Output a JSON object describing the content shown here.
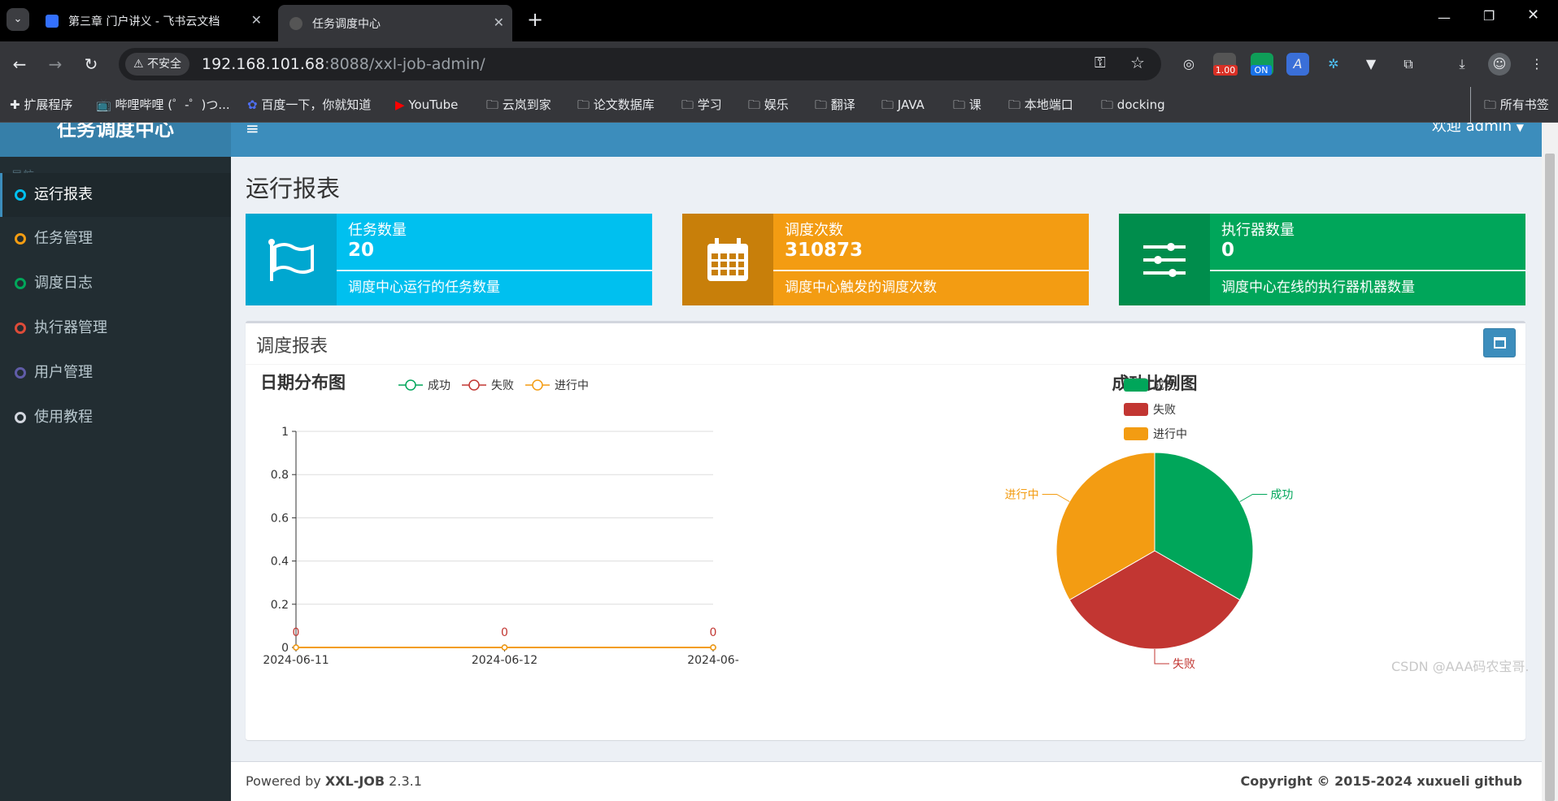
{
  "browser": {
    "tabs": [
      {
        "title": "第三章 门户讲义 - 飞书云文档"
      },
      {
        "title": "任务调度中心"
      }
    ],
    "new_tab": "+",
    "security_label": "不安全",
    "url_host": "192.168.101.68",
    "url_rest": ":8088/xxl-job-admin/",
    "ext_badges": [
      "1.00",
      "ON"
    ],
    "bookmarks": [
      "扩展程序",
      "哔哩哔哩 (゜-゜)つ...",
      "百度一下，你就知道",
      "YouTube",
      "云岚到家",
      "论文数据库",
      "学习",
      "娱乐",
      "翻译",
      "JAVA",
      "课",
      "本地端口",
      "docking"
    ],
    "all_bookmarks": "所有书签"
  },
  "app": {
    "logo": "任务调度中心",
    "nav_header": "导航",
    "menu": [
      {
        "label": "运行报表",
        "color": "#00c0ef"
      },
      {
        "label": "任务管理",
        "color": "#f39c12"
      },
      {
        "label": "调度日志",
        "color": "#00a65a"
      },
      {
        "label": "执行器管理",
        "color": "#dd4b39"
      },
      {
        "label": "用户管理",
        "color": "#605ca8"
      },
      {
        "label": "使用教程",
        "color": "#d2d6de"
      }
    ],
    "welcome": "欢迎 admin",
    "page_title": "运行报表",
    "boxes": [
      {
        "title": "任务数量",
        "number": "20",
        "desc": "调度中心运行的任务数量",
        "color": "#00c0ef",
        "icon_bg": "#00a7d0"
      },
      {
        "title": "调度次数",
        "number": "310873",
        "desc": "调度中心触发的调度次数",
        "color": "#f39c12",
        "icon_bg": "#c87f0a"
      },
      {
        "title": "执行器数量",
        "number": "0",
        "desc": "调度中心在线的执行器机器数量",
        "color": "#00a65a",
        "icon_bg": "#008d4c"
      }
    ],
    "panel_title": "调度报表",
    "footer_left_prefix": "Powered by ",
    "footer_left_brand": "XXL-JOB",
    "footer_left_version": " 2.3.1",
    "footer_right": "Copyright © 2015-2024   xuxueli   github"
  },
  "chart_data": [
    {
      "type": "line",
      "title": "日期分布图",
      "x": [
        "2024-06-11",
        "2024-06-12",
        "2024-06-"
      ],
      "series": [
        {
          "name": "成功",
          "values": [
            0,
            0,
            0
          ],
          "color": "#00a65a"
        },
        {
          "name": "失败",
          "values": [
            0,
            0,
            0
          ],
          "color": "#c23632"
        },
        {
          "name": "进行中",
          "values": [
            0,
            0,
            0
          ],
          "color": "#f39c12"
        }
      ],
      "yticks": [
        "0",
        "0.2",
        "0.4",
        "0.6",
        "0.8",
        "1"
      ],
      "ylim": [
        0,
        1
      ],
      "data_labels": [
        "0",
        "0",
        "0"
      ],
      "grid": true,
      "legend": "top"
    },
    {
      "type": "pie",
      "title": "成功比例图",
      "slices": [
        {
          "name": "成功",
          "value": 1,
          "color": "#00a65a"
        },
        {
          "name": "失败",
          "value": 1,
          "color": "#c23632"
        },
        {
          "name": "进行中",
          "value": 1,
          "color": "#f39c12"
        }
      ],
      "legend": "top-left"
    }
  ],
  "watermark": "CSDN @AAA码农宝哥."
}
